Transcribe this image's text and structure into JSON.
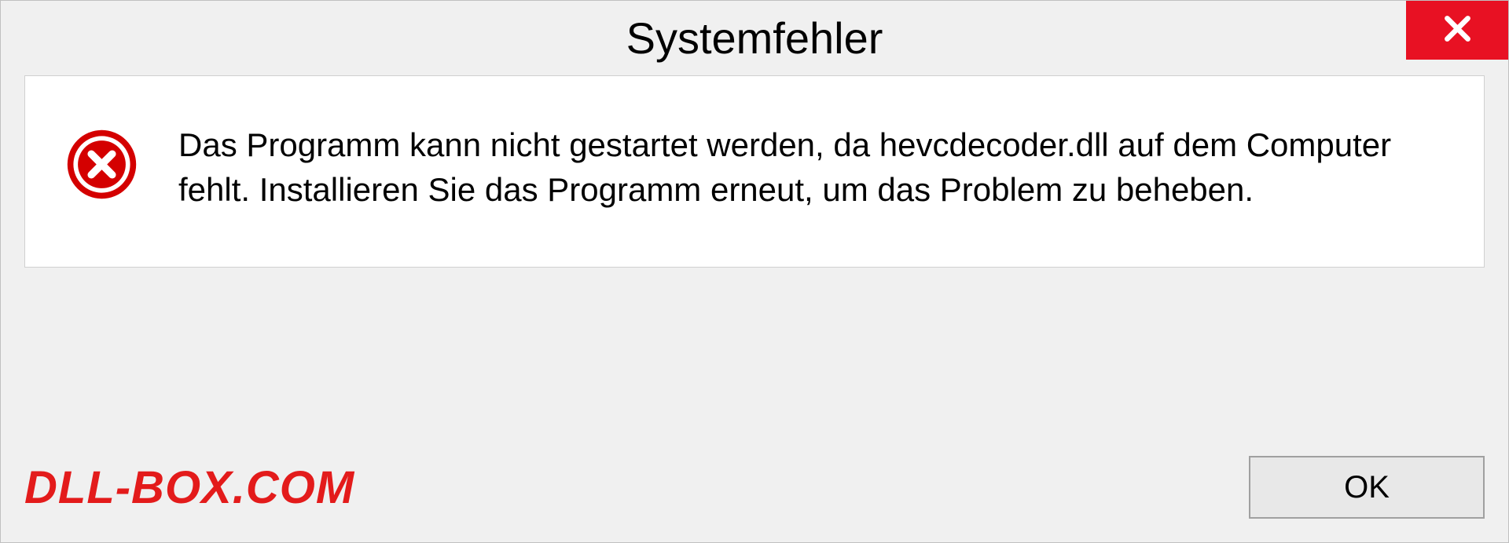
{
  "dialog": {
    "title": "Systemfehler",
    "message": "Das Programm kann nicht gestartet werden, da hevcdecoder.dll auf dem Computer fehlt. Installieren Sie das Programm erneut, um das Problem zu beheben.",
    "ok_label": "OK"
  },
  "watermark": "DLL-BOX.COM",
  "colors": {
    "close_bg": "#e81123",
    "error_icon": "#d40000",
    "watermark": "#e31b1b"
  }
}
